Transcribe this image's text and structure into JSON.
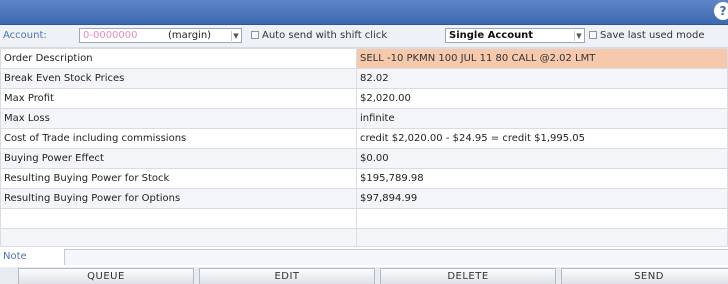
{
  "account": {
    "label": "Account:",
    "id_masked": "0-0000000",
    "type": "(margin)",
    "auto_send_label": "Auto send with shift click",
    "mode_value": "Single Account",
    "save_last_label": "Save last used mode"
  },
  "rows": [
    {
      "label": "Order Description",
      "value": "SELL -10 PKMN 100 JUL 11 80 CALL @2.02 LMT"
    },
    {
      "label": "Break Even Stock Prices",
      "value": "82.02"
    },
    {
      "label": "Max Profit",
      "value": "$2,020.00"
    },
    {
      "label": "Max Loss",
      "value": "infinite"
    },
    {
      "label": "Cost of Trade including commissions",
      "value": "credit $2,020.00 - $24.95 = credit $1,995.05"
    },
    {
      "label": "Buying Power Effect",
      "value": "$0.00"
    },
    {
      "label": "Resulting Buying Power for Stock",
      "value": "$195,789.98"
    },
    {
      "label": "Resulting Buying Power for Options",
      "value": "$97,894.99"
    },
    {
      "label": "",
      "value": ""
    },
    {
      "label": "",
      "value": ""
    }
  ],
  "note": {
    "label": "Note",
    "value": ""
  },
  "buttons": {
    "queue": "QUEUE",
    "edit": "EDIT",
    "delete": "DELETE",
    "send": "SEND"
  },
  "colors": {
    "title_bar": "#3d68b1",
    "highlight": "#f6c9ad",
    "label_blue": "#4d73b7",
    "masked_id": "#e58cc0"
  }
}
